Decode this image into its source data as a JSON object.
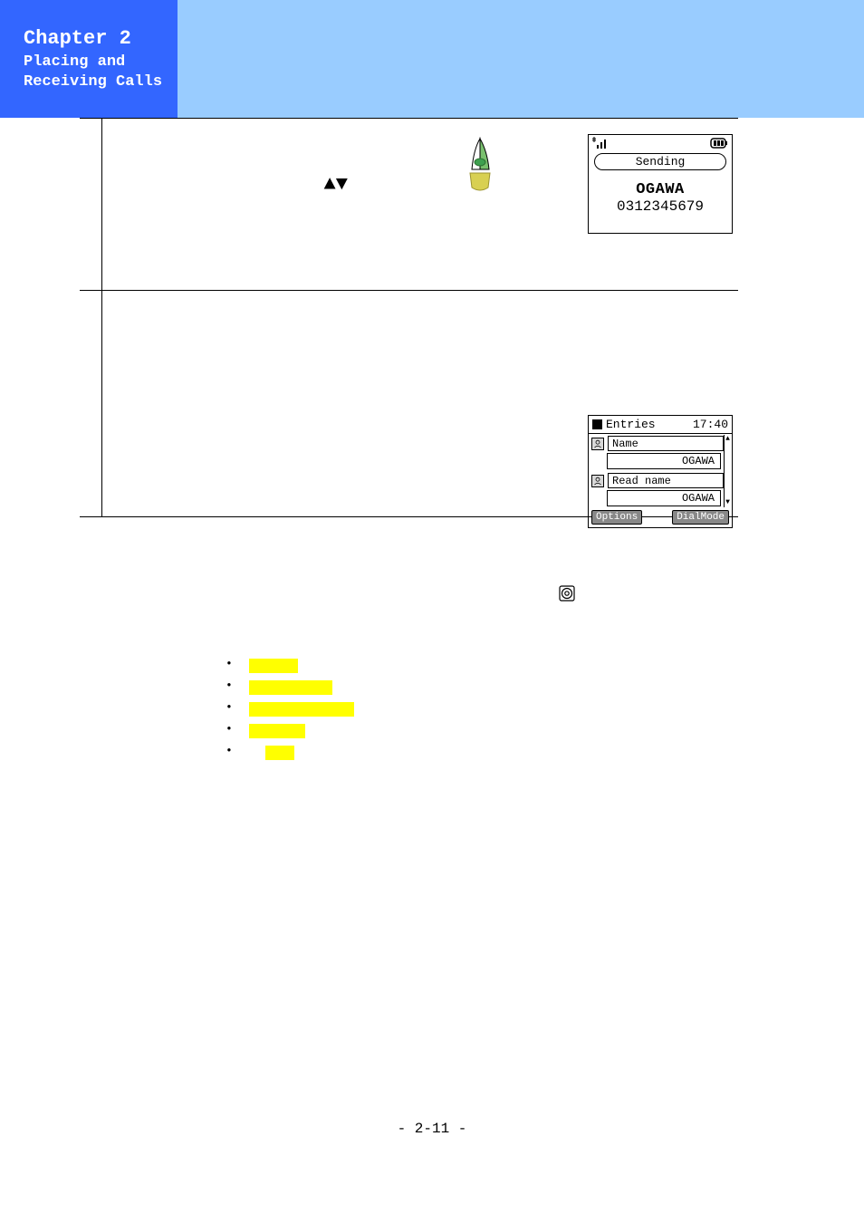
{
  "chapter": {
    "title": "Chapter 2",
    "subtitle": "Placing and\nReceiving Calls"
  },
  "row1": {
    "arrows": "▲▼",
    "phone": {
      "sending": "Sending",
      "name": "OGAWA",
      "number": "0312345679"
    }
  },
  "row2": {
    "phone": {
      "entries_label": "Entries",
      "time": "17:40",
      "name_label": "Name",
      "name_value": "OGAWA",
      "readname_label": "Read name",
      "readname_value": "OGAWA",
      "options_btn": "Options",
      "dialmode_btn": "DialMode"
    }
  },
  "page_number": "- 2-11 -"
}
